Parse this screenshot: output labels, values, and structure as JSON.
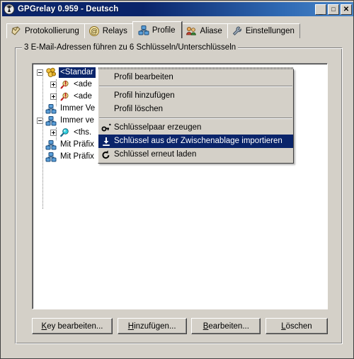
{
  "window": {
    "title": "GPGrelay 0.959 - Deutsch",
    "icon": "antenna-tower-icon",
    "minimize_label": "_",
    "maximize_label": "□",
    "close_label": "✕"
  },
  "tabs": [
    {
      "label": "Protokollierung",
      "icon": "notepad-icon",
      "selected": false
    },
    {
      "label": "Relays",
      "icon": "at-sign-icon",
      "selected": false
    },
    {
      "label": "Profile",
      "icon": "profiles-icon",
      "selected": true
    },
    {
      "label": "Aliase",
      "icon": "people-icon",
      "selected": false
    },
    {
      "label": "Einstellungen",
      "icon": "wrench-icon",
      "selected": false
    }
  ],
  "groupbox": {
    "label": "3 E-Mail-Adressen führen zu 6 Schlüsseln/Unterschlüsseln"
  },
  "tree": {
    "items": [
      {
        "label": "<Standar",
        "icon": "keys-gold-icon",
        "expander": "minus",
        "indent": 0,
        "selected": true
      },
      {
        "label": "<ade",
        "icon": "key-red-icon",
        "expander": "plus",
        "indent": 1,
        "selected": false
      },
      {
        "label": "<ade",
        "icon": "key-red-icon",
        "expander": "plus",
        "indent": 1,
        "selected": false
      },
      {
        "label": "Immer Ve",
        "icon": "keys-blue-icon",
        "expander": "none",
        "indent": 0,
        "selected": false
      },
      {
        "label": "Immer ve",
        "icon": "keys-blue-icon",
        "expander": "minus",
        "indent": 0,
        "selected": false
      },
      {
        "label": "<ths.",
        "icon": "key-cyan-icon",
        "expander": "plus",
        "indent": 1,
        "selected": false
      },
      {
        "label": "Mit Präfix",
        "icon": "keys-blue-icon",
        "expander": "none",
        "indent": 0,
        "selected": false
      },
      {
        "label": "Mit Präfix",
        "icon": "keys-blue-icon",
        "expander": "none",
        "indent": 0,
        "selected": false
      }
    ]
  },
  "context_menu": {
    "items": [
      {
        "label": "Profil bearbeiten",
        "icon": "",
        "highlighted": false,
        "type": "item"
      },
      {
        "type": "separator"
      },
      {
        "label": "Profil hinzufügen",
        "icon": "",
        "highlighted": false,
        "type": "item"
      },
      {
        "label": "Profil löschen",
        "icon": "",
        "highlighted": false,
        "type": "item"
      },
      {
        "type": "separator"
      },
      {
        "label": "Schlüsselpaar erzeugen",
        "icon": "key-generate-icon",
        "highlighted": false,
        "type": "item"
      },
      {
        "label": "Schlüssel aus der Zwischenablage importieren",
        "icon": "import-download-icon",
        "highlighted": true,
        "type": "item"
      },
      {
        "label": "Schlüssel erneut laden",
        "icon": "reload-icon",
        "highlighted": false,
        "type": "item"
      }
    ]
  },
  "buttons": [
    {
      "accel": "K",
      "rest": "ey bearbeiten..."
    },
    {
      "accel": "H",
      "rest": "inzufügen..."
    },
    {
      "accel": "B",
      "rest": "earbeiten..."
    },
    {
      "accel": "L",
      "rest": "öschen"
    }
  ],
  "colors": {
    "title_active": "#0a246a",
    "selection": "#0a246a",
    "face": "#d4d0c8",
    "panel_bg": "#ffffff"
  }
}
